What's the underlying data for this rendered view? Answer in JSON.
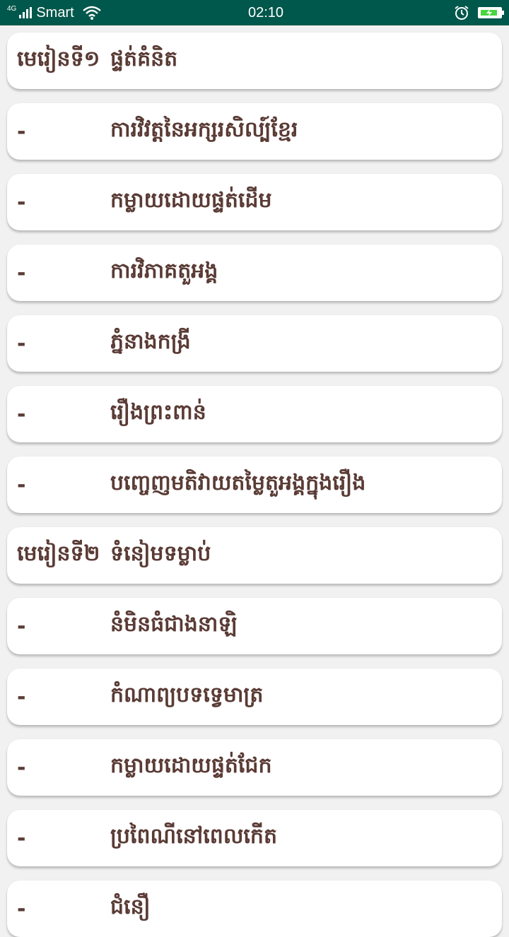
{
  "status_bar": {
    "network_type": "4G",
    "carrier": "Smart",
    "time": "02:10",
    "icons": [
      "signal-icon",
      "wifi-icon",
      "alarm-icon",
      "battery-charging-icon"
    ],
    "battery_level": 0.9,
    "colors": {
      "background": "#00574b",
      "battery_fill": "#49d640"
    }
  },
  "list": {
    "text_color": "#5a3b35",
    "items": [
      {
        "prefix": "មេរៀនទី១",
        "title": "ផ្ទត់គំនិត"
      },
      {
        "prefix": "-",
        "title": "ការវិវត្តនៃអក្សរសិល្ប៍ខ្មែរ"
      },
      {
        "prefix": "-",
        "title": "កម្លាយដោយផ្ទត់ដើម"
      },
      {
        "prefix": "-",
        "title": "ការវិភាគតួអង្គ"
      },
      {
        "prefix": "-",
        "title": "ភ្នំនាងកង្រី"
      },
      {
        "prefix": "-",
        "title": "រឿងព្រះពាន់"
      },
      {
        "prefix": "-",
        "title": "បញ្ចេញមតិវាយតម្លៃតួអង្គក្នុងរឿង"
      },
      {
        "prefix": "មេរៀនទី២",
        "title": "ទំនៀមទម្លាប់"
      },
      {
        "prefix": "-",
        "title": "នំមិនធំជាងនាឡិ"
      },
      {
        "prefix": "-",
        "title": "កំណាព្យបទទ្វេមាត្រ"
      },
      {
        "prefix": "-",
        "title": "កម្លាយដោយផ្ទត់ជែក"
      },
      {
        "prefix": "-",
        "title": "ប្រពៃណីនៅពេលកើត"
      },
      {
        "prefix": "-",
        "title": "ជំនឿ"
      }
    ]
  }
}
